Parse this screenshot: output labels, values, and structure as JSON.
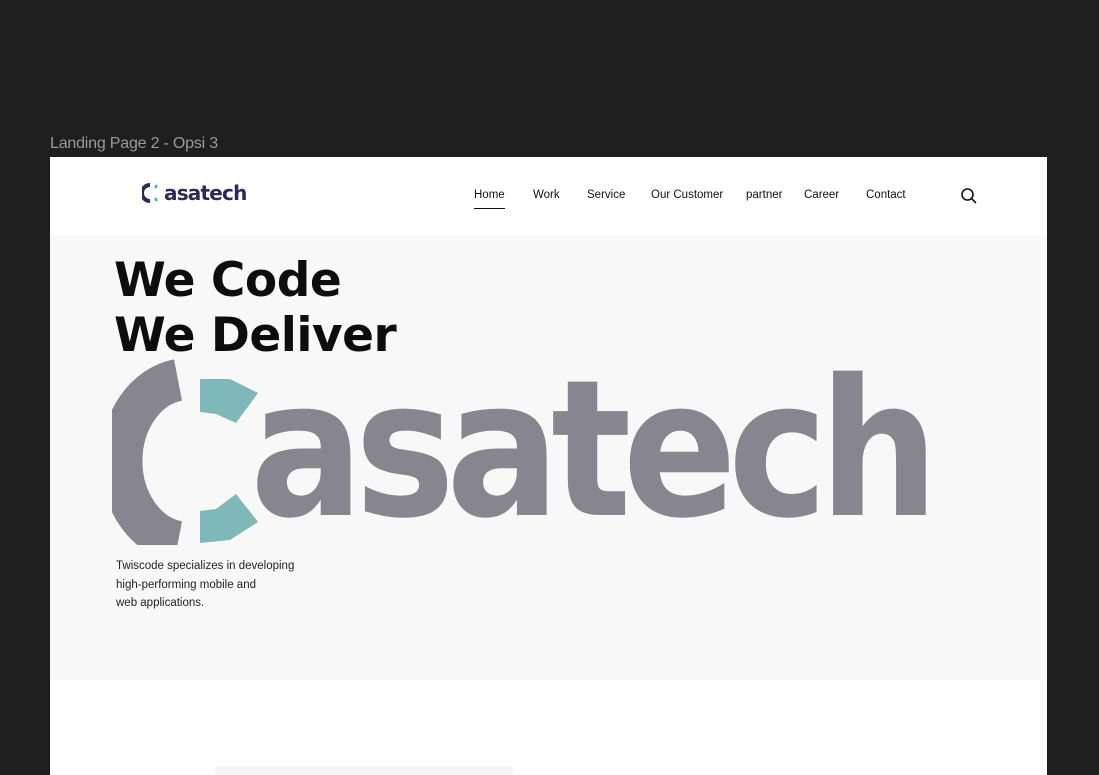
{
  "canvas": {
    "frame_title": "Landing Page 2 - Opsi 3"
  },
  "navbar": {
    "brand": "Casatech",
    "brand_text": "asatech",
    "links": [
      {
        "label": "Home",
        "active": true
      },
      {
        "label": "Work",
        "active": false
      },
      {
        "label": "Service",
        "active": false
      },
      {
        "label": "Our Customer",
        "active": false
      },
      {
        "label": "partner",
        "active": false
      },
      {
        "label": "Career",
        "active": false
      },
      {
        "label": "Contact",
        "active": false
      }
    ],
    "search_icon": "search-icon"
  },
  "hero": {
    "headline_line1": "We Code",
    "headline_line2": "We Deliver",
    "logo_word": "asatech",
    "description_lines": [
      "Twiscode specializes in developing",
      "high-performing mobile and",
      "web applications."
    ]
  },
  "colors": {
    "page_bg": "#1e1e1e",
    "hero_bg": "#f8f8f8",
    "brand_navy": "#2c2a57",
    "logo_gray": "#87868f",
    "logo_teal": "#7fb8b8"
  }
}
